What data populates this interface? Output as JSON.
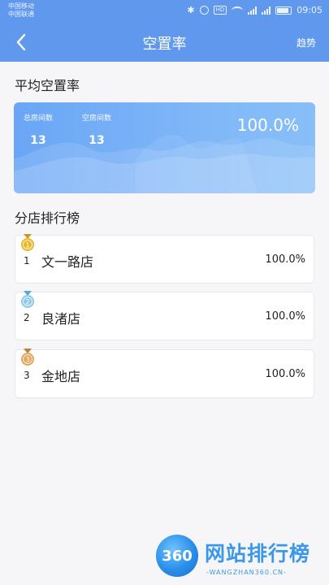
{
  "status_bar": {
    "carrier1": "中国移动",
    "carrier2": "中国联通",
    "hd": "HD",
    "time": "09:05"
  },
  "nav": {
    "title": "空置率",
    "right_action": "趋势"
  },
  "average": {
    "section_title": "平均空置率",
    "total_rooms_label": "总房间数",
    "total_rooms_value": "13",
    "empty_rooms_label": "空房间数",
    "empty_rooms_value": "13",
    "rate": "100.0%"
  },
  "ranking": {
    "section_title": "分店排行榜",
    "items": [
      {
        "rank": "1",
        "name": "文一路店",
        "rate": "100.0%",
        "medal_color": "#e8b62e"
      },
      {
        "rank": "2",
        "name": "良渚店",
        "rate": "100.0%",
        "medal_color": "#8ec9e8"
      },
      {
        "rank": "3",
        "name": "金地店",
        "rate": "100.0%",
        "medal_color": "#e0a866"
      }
    ]
  },
  "watermark": {
    "logo_text": "360",
    "title": "网站排行榜",
    "subtitle": "-WANGZHAN360.CN-"
  },
  "colors": {
    "header_bg": "#5f98ec",
    "card_gradient_start": "#6aa6f5",
    "card_gradient_end": "#88bff8",
    "page_bg": "#f6f6f8"
  }
}
